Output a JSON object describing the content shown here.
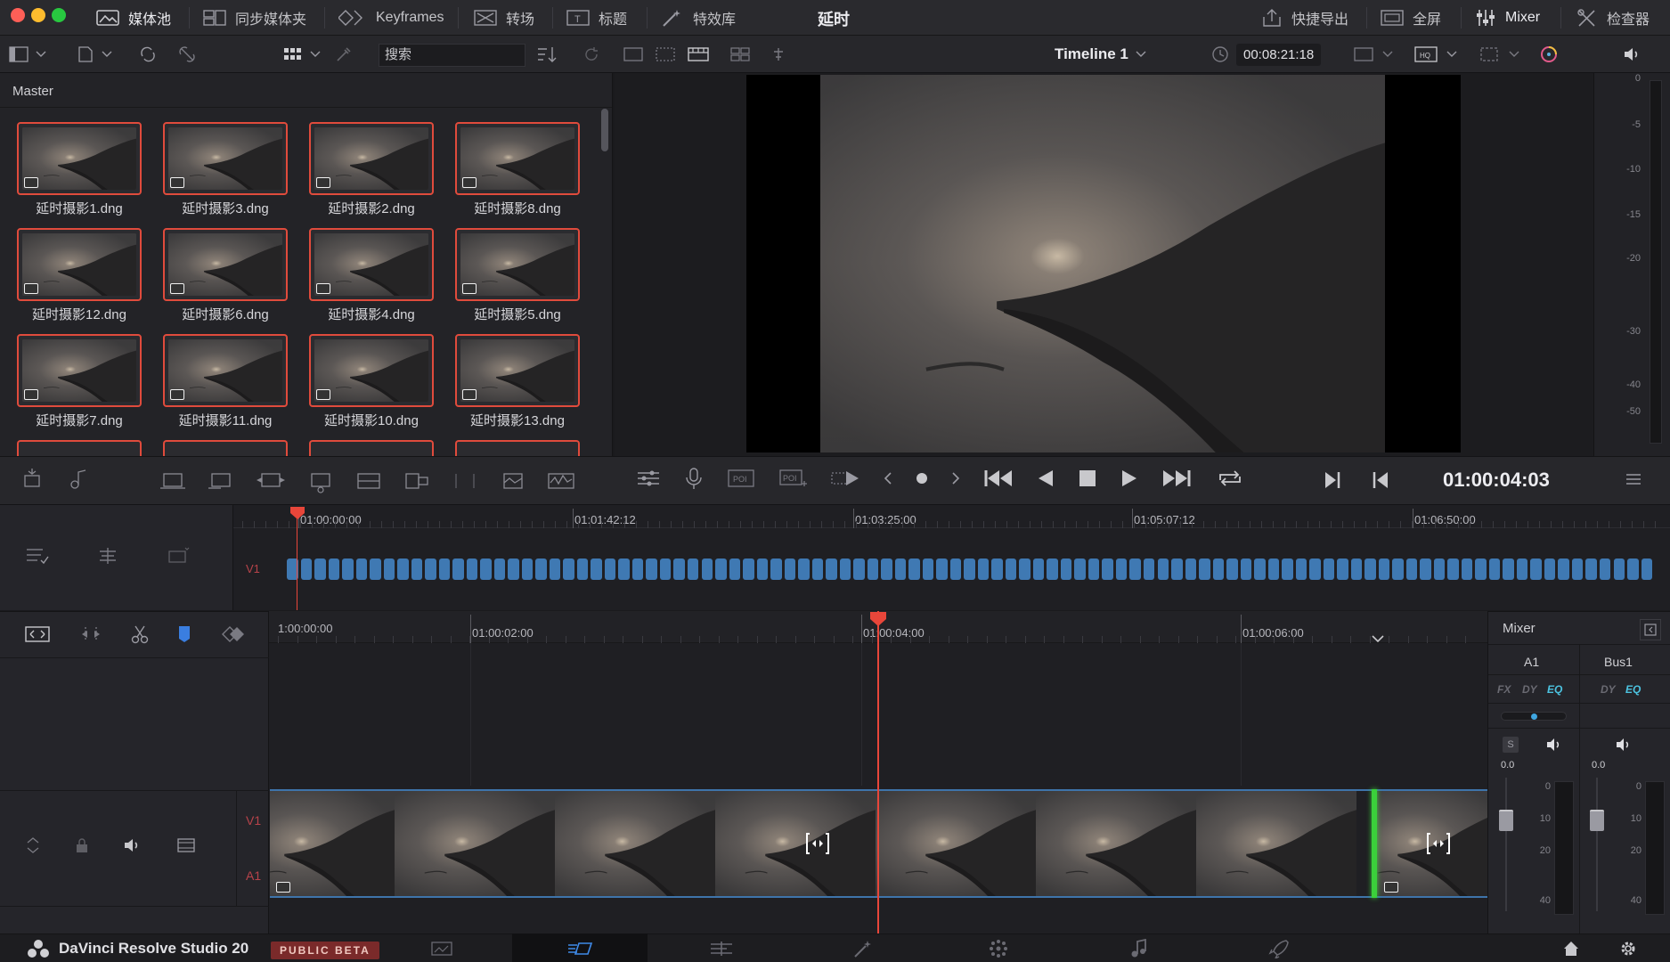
{
  "window": {
    "title": "延时"
  },
  "topbar": {
    "left_items": [
      {
        "label": "媒体池",
        "icon": "media-pool-icon",
        "active": true
      },
      {
        "label": "同步媒体夹",
        "icon": "sync-bin-icon"
      },
      {
        "label": "Keyframes",
        "icon": "keyframes-icon"
      },
      {
        "label": "转场",
        "icon": "transitions-icon"
      },
      {
        "label": "标题",
        "icon": "titles-icon"
      },
      {
        "label": "特效库",
        "icon": "effects-icon"
      }
    ],
    "right_items": [
      {
        "label": "快捷导出",
        "icon": "export-icon"
      },
      {
        "label": "全屏",
        "icon": "fullscreen-icon"
      },
      {
        "label": "Mixer",
        "icon": "mixer-icon",
        "active": true
      },
      {
        "label": "检查器",
        "icon": "inspector-icon"
      }
    ]
  },
  "toolbar": {
    "search_placeholder": "搜索",
    "timeline_name": "Timeline 1",
    "timeline_duration": "00:08:21:18"
  },
  "media_pool": {
    "bin_name": "Master",
    "clips": [
      "延时摄影1.dng",
      "延时摄影3.dng",
      "延时摄影2.dng",
      "延时摄影8.dng",
      "延时摄影12.dng",
      "延时摄影6.dng",
      "延时摄影4.dng",
      "延时摄影5.dng",
      "延时摄影7.dng",
      "延时摄影11.dng",
      "延时摄影10.dng",
      "延时摄影13.dng"
    ]
  },
  "meter": {
    "ticks": [
      "0",
      "-5",
      "-10",
      "-15",
      "-20",
      "-30",
      "-40",
      "-50"
    ]
  },
  "transport": {
    "timecode": "01:00:04:03"
  },
  "mini_timeline": {
    "track": "V1",
    "ruler": [
      "01:00:00:00",
      "01:01:42:12",
      "01:03:25:00",
      "01:05:07:12",
      "01:06:50:00"
    ],
    "clip_count": 99
  },
  "timeline": {
    "ruler": [
      "01:00:02:00",
      "01:00:04:00",
      "01:00:06:00"
    ],
    "ruler_partial_first": "1:00:00:00",
    "tracks": {
      "video": "V1",
      "audio": "A1"
    }
  },
  "mixer": {
    "title": "Mixer",
    "channels": [
      {
        "name": "A1",
        "buttons": [
          "FX",
          "DY",
          "EQ"
        ],
        "level": "0.0",
        "solo": "S"
      },
      {
        "name": "Bus1",
        "buttons": [
          "DY",
          "EQ"
        ],
        "level": "0.0"
      }
    ],
    "scale": [
      "0",
      "10",
      "20",
      "40"
    ]
  },
  "bottombar": {
    "app_name": "DaVinci Resolve Studio 20",
    "badge": "PUBLIC BETA"
  },
  "colors": {
    "accent_red": "#e04b3c",
    "playhead": "#e8463a",
    "clip_blue": "#3f79b3",
    "eq_cyan": "#4cc3e0"
  }
}
